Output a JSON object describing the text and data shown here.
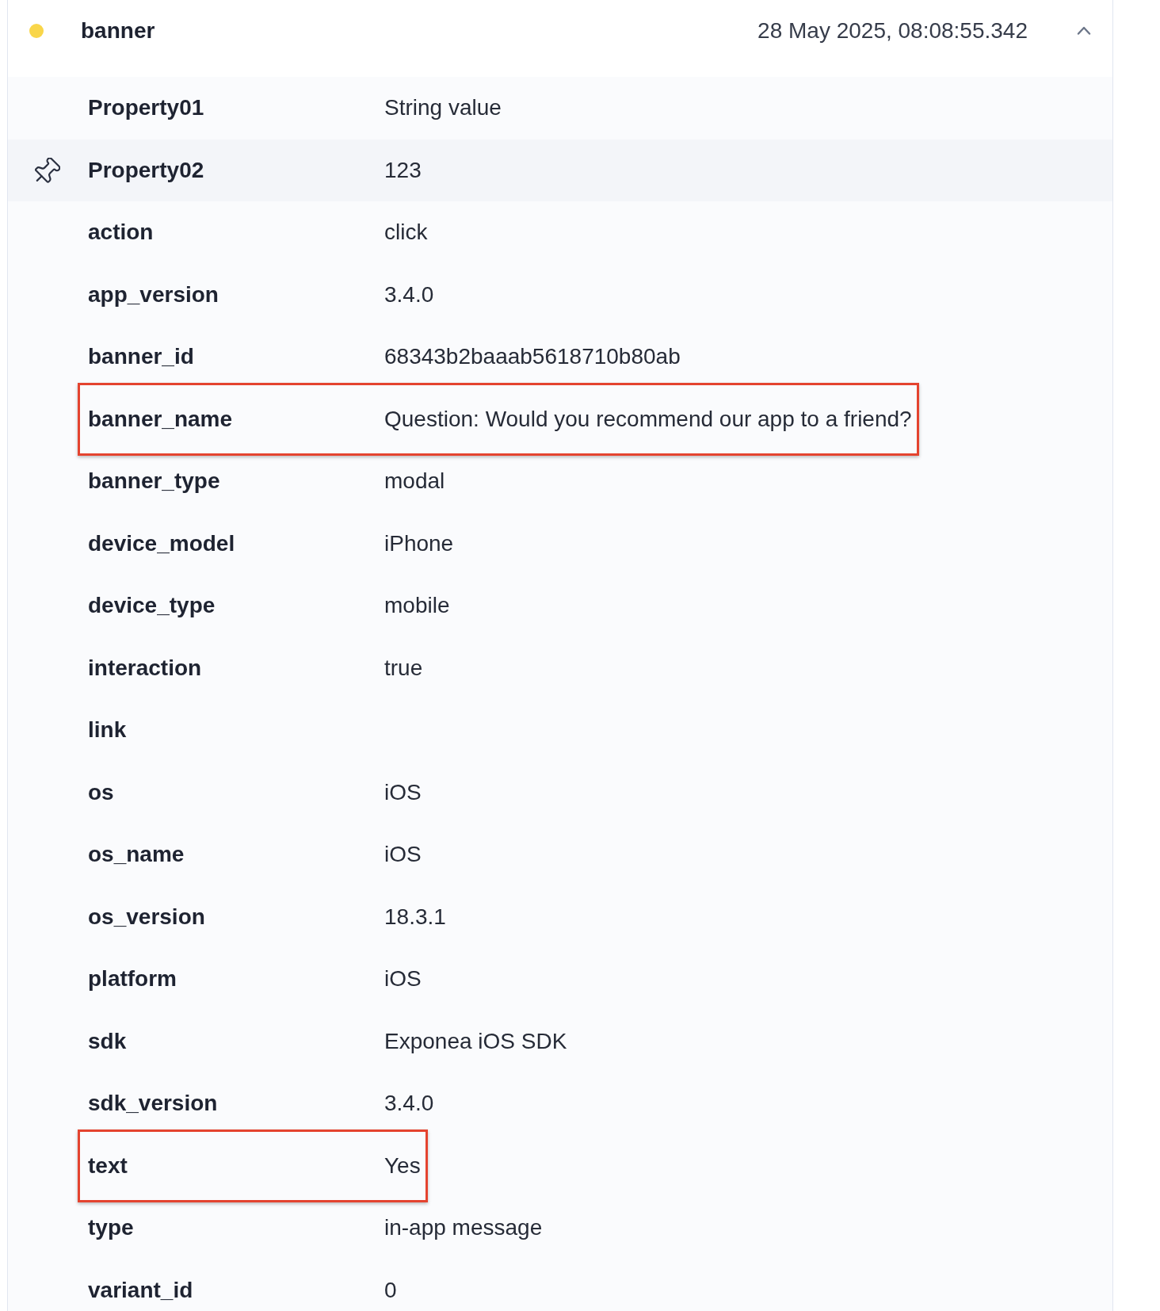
{
  "event": {
    "name": "banner",
    "timestamp": "28 May 2025, 08:08:55.342",
    "color": "#f9d64a",
    "expanded": true
  },
  "properties": [
    {
      "key": "Property01",
      "value": "String value",
      "hovered": false,
      "highlighted": false
    },
    {
      "key": "Property02",
      "value": "123",
      "hovered": true,
      "highlighted": false
    },
    {
      "key": "action",
      "value": "click",
      "hovered": false,
      "highlighted": false
    },
    {
      "key": "app_version",
      "value": "3.4.0",
      "hovered": false,
      "highlighted": false
    },
    {
      "key": "banner_id",
      "value": "68343b2baaab5618710b80ab",
      "hovered": false,
      "highlighted": false
    },
    {
      "key": "banner_name",
      "value": "Question: Would you recommend our app to a friend?",
      "hovered": false,
      "highlighted": true
    },
    {
      "key": "banner_type",
      "value": "modal",
      "hovered": false,
      "highlighted": false
    },
    {
      "key": "device_model",
      "value": "iPhone",
      "hovered": false,
      "highlighted": false
    },
    {
      "key": "device_type",
      "value": "mobile",
      "hovered": false,
      "highlighted": false
    },
    {
      "key": "interaction",
      "value": "true",
      "hovered": false,
      "highlighted": false
    },
    {
      "key": "link",
      "hovered": false,
      "highlighted": false
    },
    {
      "key": "os",
      "value": "iOS",
      "hovered": false,
      "highlighted": false
    },
    {
      "key": "os_name",
      "value": "iOS",
      "hovered": false,
      "highlighted": false
    },
    {
      "key": "os_version",
      "value": "18.3.1",
      "hovered": false,
      "highlighted": false
    },
    {
      "key": "platform",
      "value": "iOS",
      "hovered": false,
      "highlighted": false
    },
    {
      "key": "sdk",
      "value": "Exponea iOS SDK",
      "hovered": false,
      "highlighted": false
    },
    {
      "key": "sdk_version",
      "value": "3.4.0",
      "hovered": false,
      "highlighted": false
    },
    {
      "key": "text",
      "value": "Yes",
      "hovered": false,
      "highlighted": true
    },
    {
      "key": "type",
      "value": "in-app message",
      "hovered": false,
      "highlighted": false
    },
    {
      "key": "variant_id",
      "value": "0",
      "hovered": false,
      "highlighted": false
    }
  ]
}
